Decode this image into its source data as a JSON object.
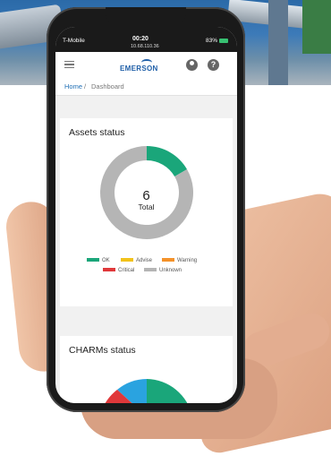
{
  "status_bar": {
    "carrier": "T-Mobile",
    "time": "00:20",
    "url": "10.68.110.36",
    "battery": "83%"
  },
  "header": {
    "logo": "EMERSON"
  },
  "breadcrumb": {
    "home": "Home",
    "separator": "/",
    "current": "Dashboard"
  },
  "assets_status": {
    "title": "Assets status",
    "total_value": "6",
    "total_label": "Total",
    "legend": [
      {
        "label": "OK",
        "color": "#1aa67a"
      },
      {
        "label": "Advise",
        "color": "#f2c21a"
      },
      {
        "label": "Warning",
        "color": "#f4922a"
      },
      {
        "label": "Critical",
        "color": "#e0383a"
      },
      {
        "label": "Unknown",
        "color": "#b5b5b5"
      }
    ]
  },
  "charms_status": {
    "title": "CHARMs status"
  },
  "chart_data": [
    {
      "type": "pie",
      "title": "Assets status",
      "categories": [
        "OK",
        "Advise",
        "Warning",
        "Critical",
        "Unknown"
      ],
      "values": [
        1,
        0,
        0,
        0,
        5
      ],
      "colors": [
        "#1aa67a",
        "#f2c21a",
        "#f4922a",
        "#e0383a",
        "#b5b5b5"
      ],
      "legend": "bottom"
    }
  ]
}
